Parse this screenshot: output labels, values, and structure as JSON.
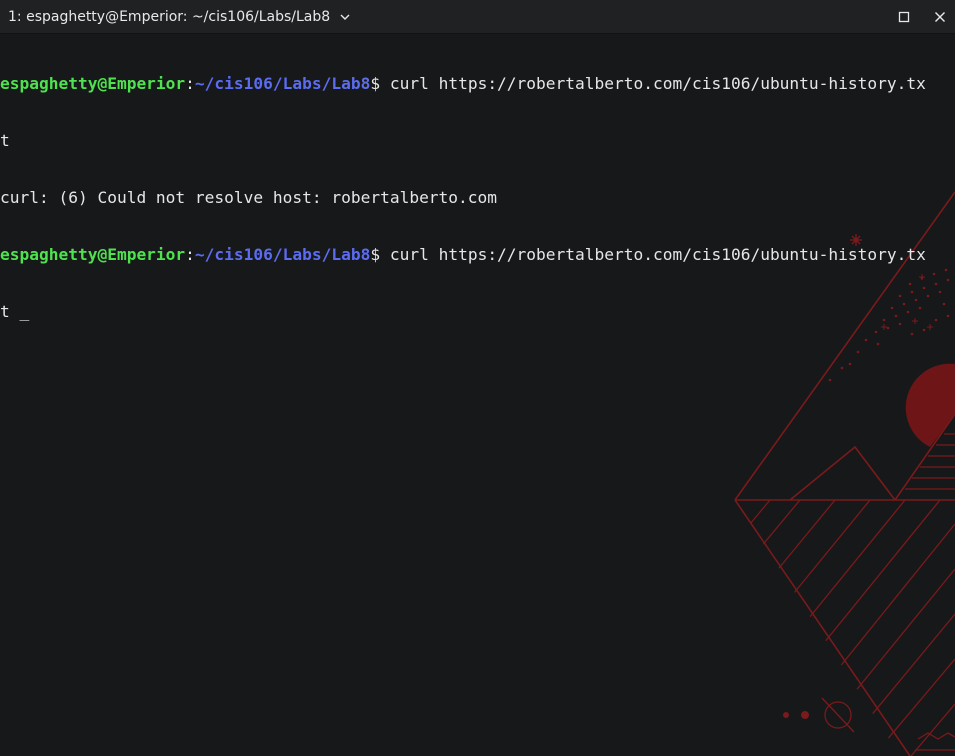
{
  "window": {
    "tab_title": "1: espaghetty@Emperior: ~/cis106/Labs/Lab8",
    "maximize_icon": "maximize-icon",
    "close_icon": "close-icon"
  },
  "colors": {
    "background": "#171819",
    "titlebar": "#202123",
    "user_host": "#4ee34e",
    "path": "#5b6cf0",
    "text": "#e6e6e6",
    "wallpaper_accent": "#7a1a1c"
  },
  "terminal": {
    "lines": [
      {
        "user_host": "espaghetty@Emperior",
        "colon": ":",
        "path": "~/cis106/Labs/Lab8",
        "prompt": "$ ",
        "command": "curl https://robertalberto.com/cis106/ubuntu-history.tx"
      },
      {
        "text": "t"
      },
      {
        "text": "curl: (6) Could not resolve host: robertalberto.com"
      },
      {
        "user_host": "espaghetty@Emperior",
        "colon": ":",
        "path": "~/cis106/Labs/Lab8",
        "prompt": "$ ",
        "command": "curl https://robertalberto.com/cis106/ubuntu-history.tx"
      },
      {
        "text": "t ",
        "cursor": "_"
      }
    ]
  }
}
